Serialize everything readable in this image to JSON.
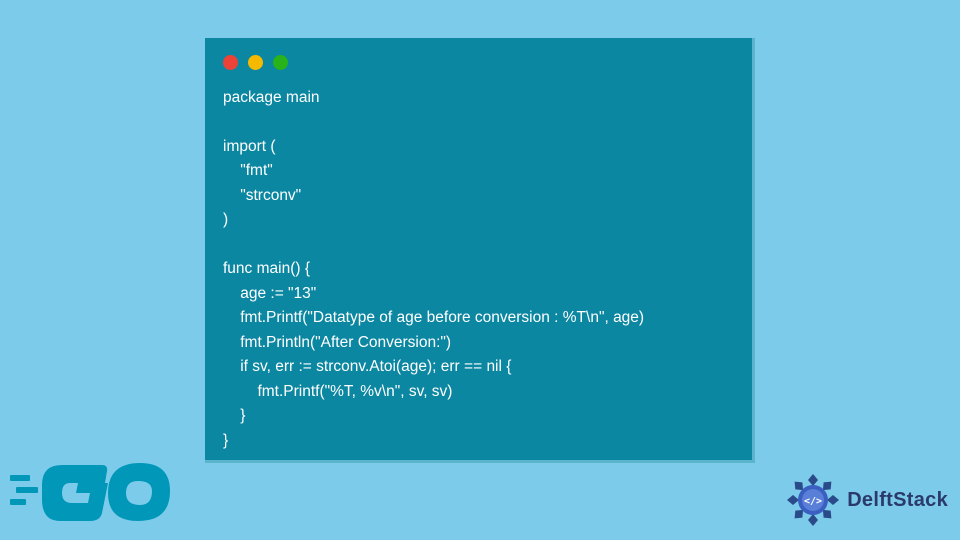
{
  "code": {
    "line1": "package main",
    "line2": "",
    "line3": "import (",
    "line4": "    \"fmt\"",
    "line5": "    \"strconv\"",
    "line6": ")",
    "line7": "",
    "line8": "func main() {",
    "line9": "    age := \"13\"",
    "line10": "    fmt.Printf(\"Datatype of age before conversion : %T\\n\", age)",
    "line11": "    fmt.Println(\"After Conversion:\")",
    "line12": "    if sv, err := strconv.Atoi(age); err == nil {",
    "line13": "        fmt.Printf(\"%T, %v\\n\", sv, sv)",
    "line14": "    }",
    "line15": "}"
  },
  "branding": {
    "delftstack": "DelftStack"
  },
  "colors": {
    "page_bg": "#7ccbea",
    "window_bg": "#0c87a2",
    "dot_red": "#ec4238",
    "dot_yellow": "#f5b900",
    "dot_green": "#29b31a",
    "go_color": "#0097b8",
    "delft_text": "#2a3a6a"
  }
}
